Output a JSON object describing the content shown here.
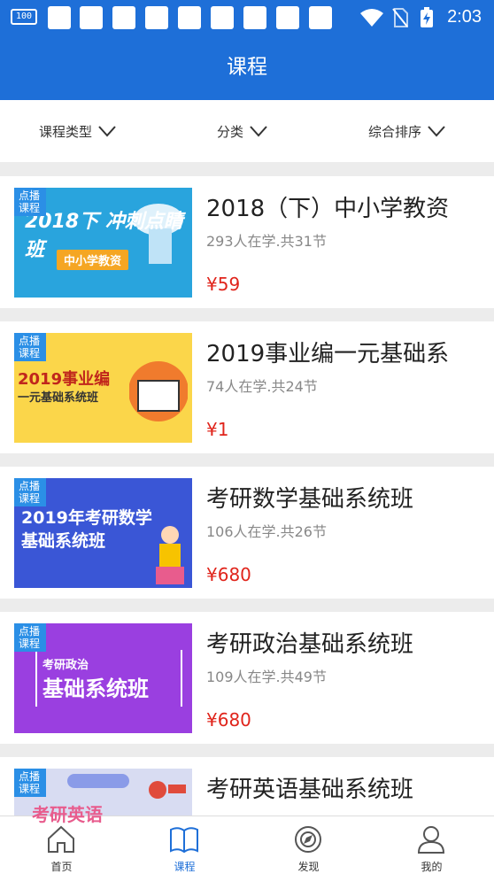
{
  "status_bar": {
    "battery_small_label": "100",
    "time": "2:03",
    "icons": [
      "wifi-icon",
      "no-sim-icon",
      "battery-charging-icon"
    ]
  },
  "header": {
    "title": "课程"
  },
  "filters": [
    {
      "label": "课程类型"
    },
    {
      "label": "分类"
    },
    {
      "label": "综合排序"
    }
  ],
  "courses": [
    {
      "thumb_tag": "点播 课程",
      "thumb_text": "2018下 冲刺点睛班",
      "thumb_sub": "中小学教资",
      "thumb_bg": "#29a4dd",
      "title": "2018（下）中小学教资",
      "meta": "293人在学.共31节",
      "price": "¥59"
    },
    {
      "thumb_tag": "点播 课程",
      "thumb_text": "2019事业编",
      "thumb_sub": "一元基础系统班",
      "thumb_bg": "#fbd64a",
      "title": "2019事业编一元基础系",
      "meta": "74人在学.共24节",
      "price": "¥1"
    },
    {
      "thumb_tag": "点播 课程",
      "thumb_text": "2019年考研数学",
      "thumb_sub": "基础系统班",
      "thumb_bg": "#3a56d6",
      "title": "考研数学基础系统班",
      "meta": "106人在学.共26节",
      "price": "¥680"
    },
    {
      "thumb_tag": "点播 课程",
      "thumb_text": "考研政治",
      "thumb_sub": "基础系统班",
      "thumb_bg": "#9a3fe0",
      "title": "考研政治基础系统班",
      "meta": "109人在学.共49节",
      "price": "¥680"
    },
    {
      "thumb_tag": "点播 课程",
      "thumb_text": "考研英语",
      "thumb_sub": "",
      "thumb_bg": "#d8dcf2",
      "title": "考研英语基础系统班",
      "meta": "",
      "price": ""
    }
  ],
  "tabbar": [
    {
      "label": "首页",
      "icon": "home-icon",
      "active": false
    },
    {
      "label": "课程",
      "icon": "book-icon",
      "active": true
    },
    {
      "label": "发现",
      "icon": "compass-icon",
      "active": false
    },
    {
      "label": "我的",
      "icon": "person-icon",
      "active": false
    }
  ],
  "colors": {
    "primary": "#1e6fd8",
    "price": "#e0241b",
    "tag": "#2b8fe6"
  }
}
